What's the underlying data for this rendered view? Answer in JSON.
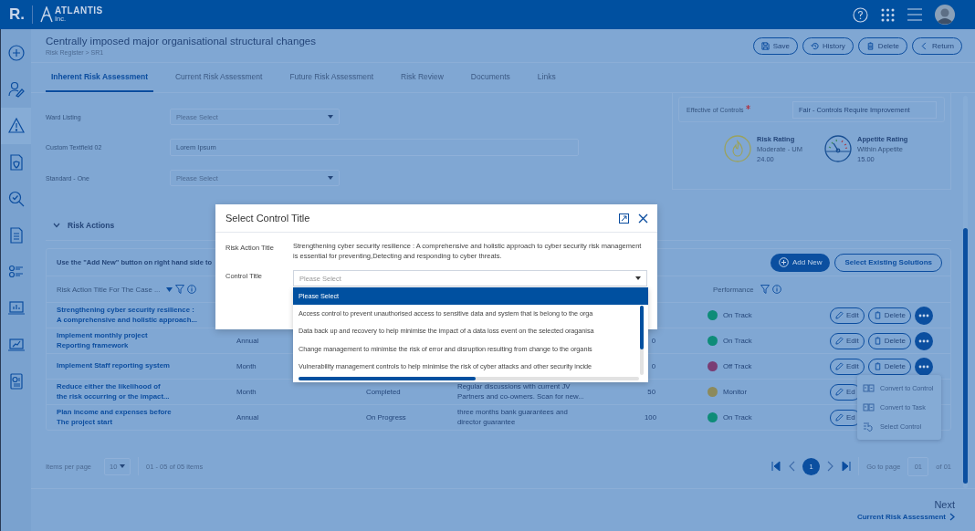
{
  "topbar": {
    "logo_mark": "R.",
    "brand": "ATLANTIS",
    "brand_sub": "Inc."
  },
  "sidebar": [
    {
      "kind": "add",
      "selected": false
    },
    {
      "kind": "profile",
      "selected": false
    },
    {
      "kind": "warning",
      "selected": true
    },
    {
      "kind": "shield-doc",
      "selected": false
    },
    {
      "kind": "search",
      "selected": false
    },
    {
      "kind": "document",
      "selected": false
    },
    {
      "kind": "checklist",
      "selected": false
    },
    {
      "kind": "dashboard",
      "selected": false
    },
    {
      "kind": "trend",
      "selected": false
    },
    {
      "kind": "report",
      "selected": false
    }
  ],
  "page": {
    "title": "Centrally imposed major organisational structural changes",
    "breadcrumb": "Risk Register > SR1",
    "actions": [
      {
        "kind": "save",
        "label": "Save"
      },
      {
        "kind": "history",
        "label": "History"
      },
      {
        "kind": "delete",
        "label": "Delete"
      },
      {
        "kind": "return",
        "label": "Return"
      }
    ]
  },
  "tabs": [
    {
      "label": "Inherent Risk Assessment",
      "selected": true
    },
    {
      "label": "Current Risk Assessment",
      "selected": false
    },
    {
      "label": "Future Risk Assessment",
      "selected": false
    },
    {
      "label": "Risk Review",
      "selected": false
    },
    {
      "label": "Documents",
      "selected": false
    },
    {
      "label": "Links",
      "selected": false
    }
  ],
  "form_fields": [
    {
      "label": "Ward Listing",
      "kind": "select",
      "value": "Please Select"
    },
    {
      "label": "Custom Textfield 02",
      "kind": "text",
      "value": "Lorem Ipsum"
    },
    {
      "label": "Standard - One",
      "kind": "select",
      "value": "Please Select"
    }
  ],
  "controls_panel": {
    "label": "Effective of Controls",
    "required": true,
    "value": "Fair - Controls Require Improvement"
  },
  "ratings": [
    {
      "kind": "risk",
      "title": "Risk Rating",
      "value": "Moderate - UM",
      "score": "24.00"
    },
    {
      "kind": "appetite",
      "title": "Appetite Rating",
      "value": "Within Appetite",
      "score": "15.00"
    }
  ],
  "risk_actions": {
    "title": "Risk Actions",
    "expanded": true,
    "hint": "Use the \"Add New\" button on right hand side to",
    "buttons": [
      {
        "kind": "add",
        "label": "Add New"
      },
      {
        "kind": "select",
        "label": "Select Existing Solutions"
      }
    ],
    "columns": [
      {
        "label": "Risk Action Title For The Case ...",
        "sortable": true
      },
      {
        "label": "Performance",
        "sortable": false
      }
    ],
    "rows": [
      {
        "title": [
          "Strengthening cyber security resilience :",
          "A comprehensive and holistic approach..."
        ],
        "performance": {
          "label": "On Track",
          "color": "#0e8c78"
        },
        "edit": "Edit",
        "delete": "Delete",
        "more": true
      },
      {
        "title": [
          "Implement monthly project",
          "Reporting framework"
        ],
        "frequency": "Annual",
        "number": "0",
        "performance": {
          "label": "On Track",
          "color": "#0e8c78"
        },
        "edit": "Edit",
        "delete": "Delete",
        "more": true
      },
      {
        "title": [
          "Implement Staff reporting system"
        ],
        "frequency": "Month",
        "number": "0",
        "performance": {
          "label": "Off Track",
          "color": "#7a3d74"
        },
        "edit": "Edit",
        "delete": "Delete",
        "more": true
      },
      {
        "title": [
          "Reduce either the likelihood of",
          "the risk occurring or the impact..."
        ],
        "frequency": "Month",
        "status": "Completed",
        "description": [
          "Regular discussions with current JV",
          "Partners and co-owners. Scan for new..."
        ],
        "number": "50",
        "performance": {
          "label": "Monitor",
          "color": "#8c8a5c"
        },
        "edit": "Ed"
      },
      {
        "title": [
          "Plan income and expenses before",
          "The project start"
        ],
        "frequency": "Annual",
        "status": "On Progress",
        "description": [
          "three months bank guarantees and",
          "director guarantee"
        ],
        "number": "100",
        "performance": {
          "label": "On Track",
          "color": "#0e8c78"
        },
        "edit": "Ed"
      }
    ]
  },
  "pagination": {
    "items_per_page_label": "Items per page",
    "page_size": "10",
    "range": "01 - 05 of 05 items",
    "pages": [
      {
        "label": "1",
        "selected": true
      }
    ],
    "go_to_label": "Go to page",
    "page_input": "01",
    "page_total": "of 01"
  },
  "footer": {
    "next_label": "Next",
    "next_link": "Current Risk Assessment"
  },
  "context_menu": [
    {
      "kind": "control",
      "label": "Convert to Control"
    },
    {
      "kind": "task",
      "label": "Convert to Task"
    },
    {
      "kind": "select",
      "label": "Select Control"
    }
  ],
  "modal": {
    "title": "Select Control Title",
    "risk_action_label": "Risk Action Title",
    "risk_action_text": "Strengthening cyber security resilience : A comprehensive and holistic approach to cyber security risk management is essential for preventing,Detecting and responding to cyber threats.",
    "control_label": "Control Title",
    "placeholder": "Please Select",
    "options": [
      {
        "label": "Please Select",
        "selected": true
      },
      {
        "label": "Access control to prevent unauthorised access to sensitive data and system that is belong to the orga",
        "selected": false
      },
      {
        "label": "Data back up and recovery to help minimise the impact of a data loss event on the selected oraganisa",
        "selected": false
      },
      {
        "label": "Change management to minimise the risk of error and disruption resulting from change to the organis",
        "selected": false
      },
      {
        "label": "Vulnerability management controls to help minimise the risk of cyber attacks and other security incide",
        "selected": false
      }
    ]
  }
}
